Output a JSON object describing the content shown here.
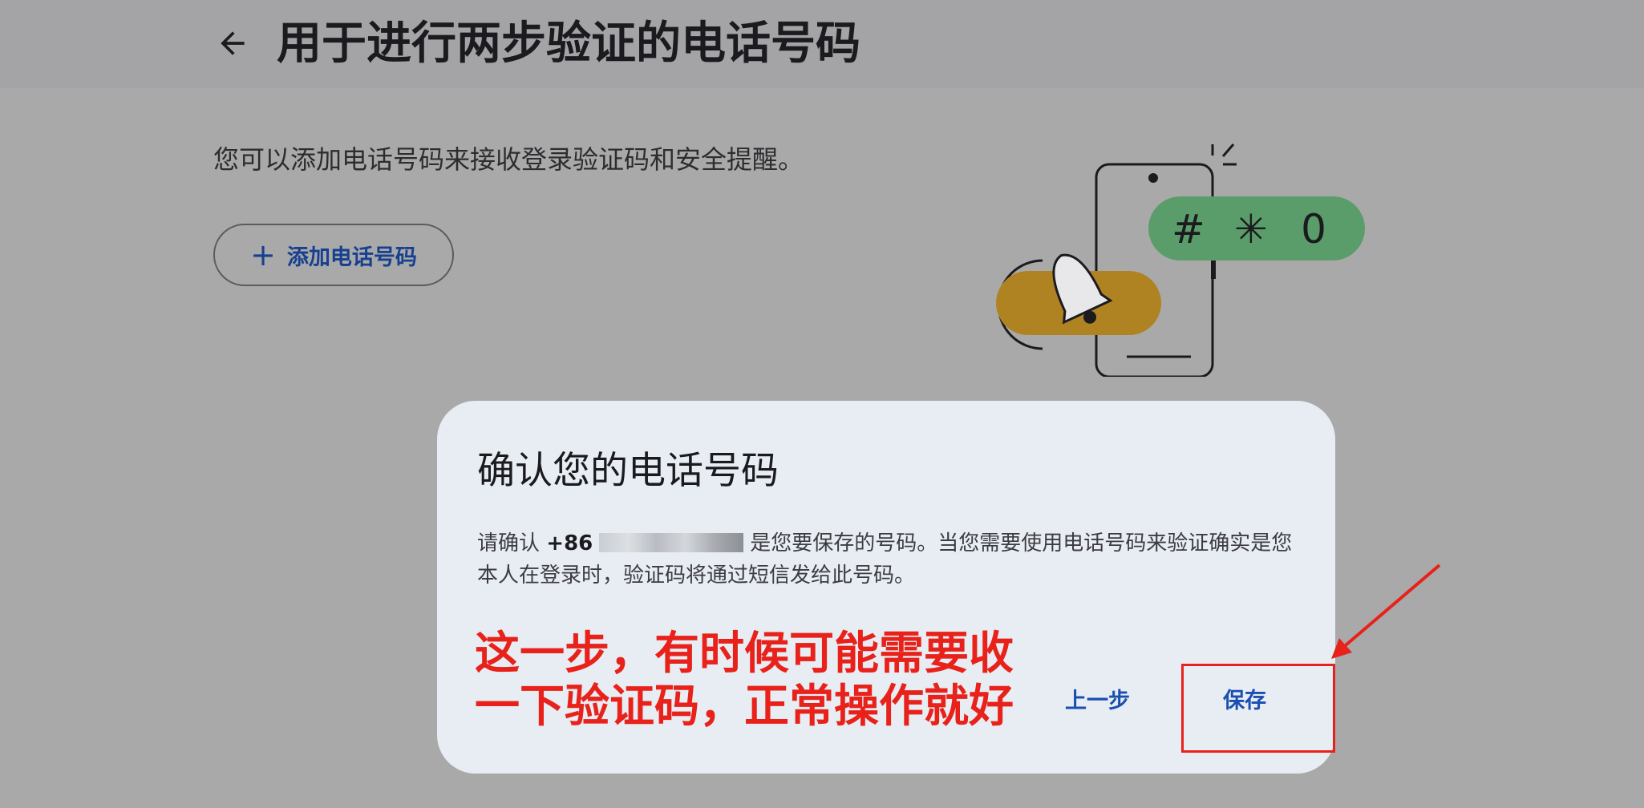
{
  "header": {
    "title": "用于进行两步验证的电话号码"
  },
  "intro": {
    "text": "您可以添加电话号码来接收登录验证码和安全提醒。"
  },
  "add_phone_button": {
    "label": "添加电话号码"
  },
  "illustration": {
    "code_chips": [
      "#",
      "✳",
      "0"
    ],
    "colors": {
      "green": "#5a9d6a",
      "yellow": "#b08322"
    }
  },
  "dialog": {
    "title": "确认您的电话号码",
    "body_prefix": "请确认",
    "phone_prefix": "+86",
    "body_suffix": "是您要保存的号码。当您需要使用电话号码来验证确实是您本人在登录时，验证码将通过短信发给此号码。",
    "prev_label": "上一步",
    "save_label": "保存"
  },
  "annotation": {
    "line1": "这一步，有时候可能需要收",
    "line2": "一下验证码，正常操作就好",
    "color": "#e8221a"
  }
}
